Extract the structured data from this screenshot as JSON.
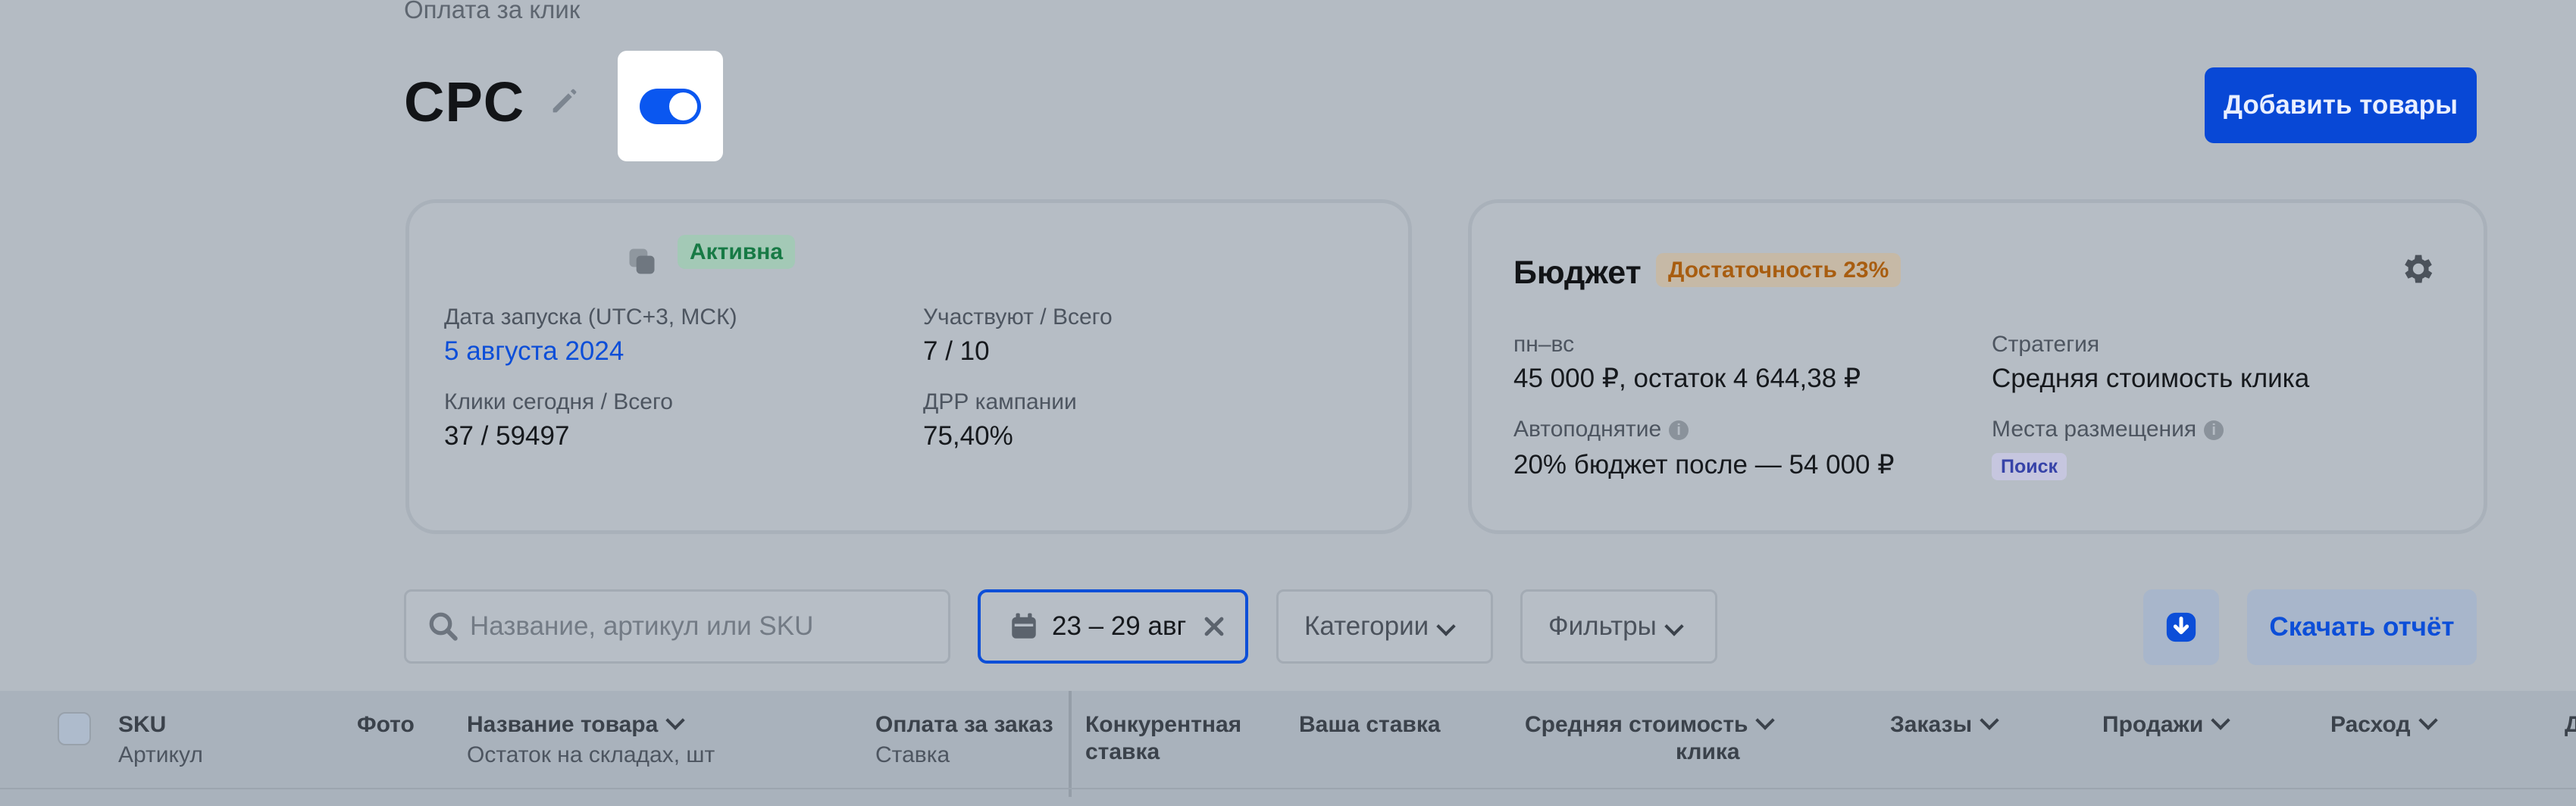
{
  "header": {
    "breadcrumb": "Оплата за клик",
    "title": "CPC",
    "add_button": "Добавить товары",
    "toggle_on": true
  },
  "campaign": {
    "status": "Активна",
    "launch_label": "Дата запуска (UTC+3, МСК)",
    "launch_value": "5 августа 2024",
    "participants_label": "Участвуют / Всего",
    "participants_value": "7 / 10",
    "clicks_label": "Клики сегодня / Всего",
    "clicks_value": "37 / 59497",
    "drr_label": "ДРР кампании",
    "drr_value": "75,40%"
  },
  "budget": {
    "title": "Бюджет",
    "badge": "Достаточность 23%",
    "period_label": "пн–вс",
    "period_value": "45 000 ₽, остаток 4 644,38 ₽",
    "strategy_label": "Стратегия",
    "strategy_value": "Средняя стоимость клика",
    "autoraise_label": "Автоподнятие",
    "autoraise_value": "20% бюджет после — 54 000 ₽",
    "placement_label": "Места размещения",
    "placement_tag": "Поиск"
  },
  "toolbar": {
    "search_placeholder": "Название, артикул или SKU",
    "date_range": "23 – 29 авг",
    "categories": "Категории",
    "filters": "Фильтры",
    "report_button": "Скачать отчёт"
  },
  "table": {
    "col_sku": "SKU",
    "col_sku_sub": "Артикул",
    "col_photo": "Фото",
    "col_name": "Название товара",
    "col_name_sub": "Остаток на складах, шт",
    "col_order_pay": "Оплата за заказ",
    "col_order_pay_sub": "Ставка",
    "col_competitive_1": "Конкурентная",
    "col_competitive_2": "ставка",
    "col_your_bid": "Ваша ставка",
    "col_avg_cost_1": "Средняя стоимость",
    "col_avg_cost_2": "клика",
    "col_orders": "Заказы",
    "col_sales": "Продажи",
    "col_spend": "Расход",
    "col_cut": "Д"
  },
  "colors": {
    "accent": "#0848d6",
    "toggle": "#0a57f0",
    "active": "#177a45",
    "warning": "#a85d10"
  }
}
